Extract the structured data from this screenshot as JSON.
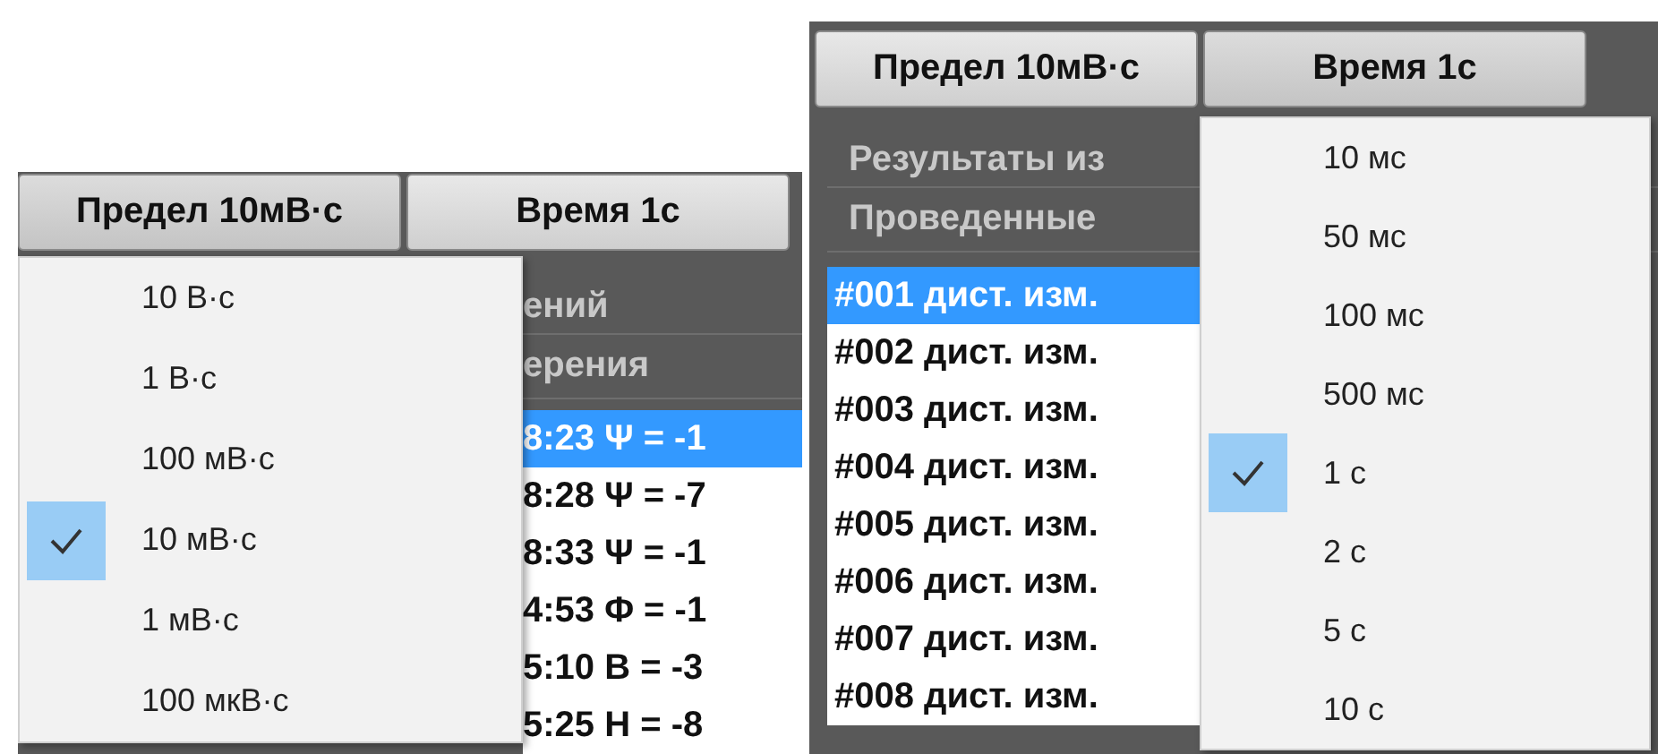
{
  "panels": [
    {
      "buttons": [
        {
          "label": "Предел 10мВ·с",
          "open": true
        },
        {
          "label": "Время 1с",
          "open": false
        }
      ],
      "group_labels": [
        "ений",
        "ерения"
      ],
      "list": [
        {
          "text": "8:23 Ψ = -1",
          "selected": true
        },
        {
          "text": "8:28 Ψ = -7",
          "selected": false
        },
        {
          "text": "8:33 Ψ = -1",
          "selected": false
        },
        {
          "text": "4:53 Φ = -1",
          "selected": false
        },
        {
          "text": "5:10 B = -3",
          "selected": false
        },
        {
          "text": "5:25 H = -8",
          "selected": false
        }
      ],
      "menu": {
        "items": [
          {
            "label": "10 В·с",
            "checked": false
          },
          {
            "label": "1 В·с",
            "checked": false
          },
          {
            "label": "100 мВ·с",
            "checked": false
          },
          {
            "label": "10 мВ·с",
            "checked": true
          },
          {
            "label": "1 мВ·с",
            "checked": false
          },
          {
            "label": "100 мкВ·с",
            "checked": false
          }
        ]
      }
    },
    {
      "buttons": [
        {
          "label": "Предел 10мВ·с",
          "open": false
        },
        {
          "label": "Время 1с",
          "open": true
        }
      ],
      "group_labels": [
        "Результаты из",
        "Проведенные"
      ],
      "list": [
        {
          "text": "#001 дист. изм.",
          "selected": true
        },
        {
          "text": "#002 дист. изм.",
          "selected": false
        },
        {
          "text": "#003 дист. изм.",
          "selected": false
        },
        {
          "text": "#004 дист. изм.",
          "selected": false
        },
        {
          "text": "#005 дист. изм.",
          "selected": false
        },
        {
          "text": "#006 дист. изм.",
          "selected": false
        },
        {
          "text": "#007 дист. изм.",
          "selected": false
        },
        {
          "text": "#008 дист. изм.",
          "selected": false
        }
      ],
      "menu": {
        "items": [
          {
            "label": "10 мс",
            "checked": false
          },
          {
            "label": "50 мс",
            "checked": false
          },
          {
            "label": "100 мс",
            "checked": false
          },
          {
            "label": "500 мс",
            "checked": false
          },
          {
            "label": "1 с",
            "checked": true
          },
          {
            "label": "2 с",
            "checked": false
          },
          {
            "label": "5 с",
            "checked": false
          },
          {
            "label": "10 с",
            "checked": false
          }
        ]
      }
    }
  ]
}
